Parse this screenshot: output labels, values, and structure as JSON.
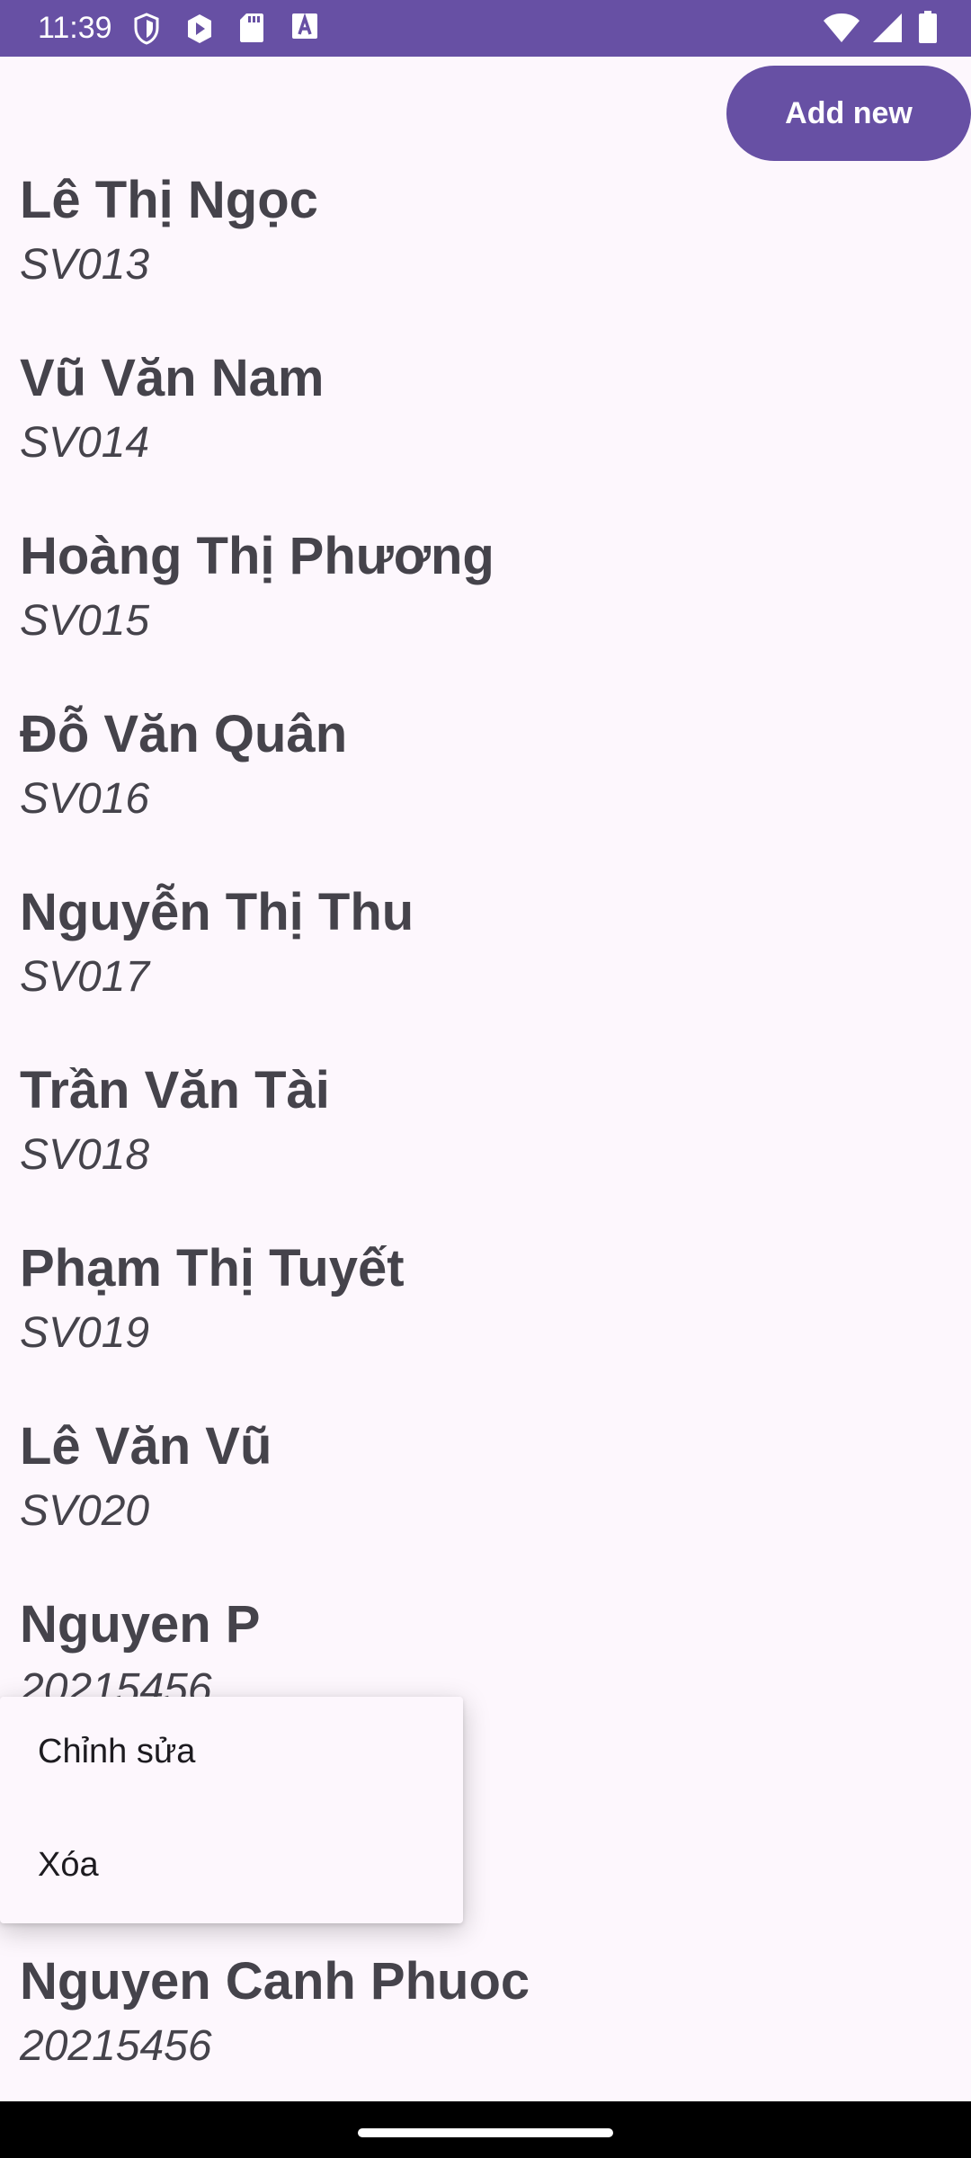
{
  "status_bar": {
    "time": "11:39",
    "icons_left": [
      "shield-icon",
      "play-store-icon",
      "sd-card-icon",
      "font-a-icon"
    ],
    "icons_right": [
      "wifi-icon",
      "cell-signal-icon",
      "battery-icon"
    ],
    "color": "#6750a4"
  },
  "header": {
    "add_button_label": "Add new"
  },
  "students": [
    {
      "name": "Lê Thị Ngọc",
      "id": "SV013"
    },
    {
      "name": "Vũ Văn Nam",
      "id": "SV014"
    },
    {
      "name": "Hoàng Thị Phương",
      "id": "SV015"
    },
    {
      "name": "Đỗ Văn Quân",
      "id": "SV016"
    },
    {
      "name": "Nguyễn Thị Thu",
      "id": "SV017"
    },
    {
      "name": "Trần Văn Tài",
      "id": "SV018"
    },
    {
      "name": "Phạm Thị Tuyết",
      "id": "SV019"
    },
    {
      "name": "Lê Văn Vũ",
      "id": "SV020"
    },
    {
      "name": "Nguyen P",
      "id": "20215456"
    },
    {
      "name": "Nguyen Canh Phuoc",
      "id": "20215456"
    }
  ],
  "context_menu": {
    "items": [
      {
        "label": "Chỉnh sửa"
      },
      {
        "label": "Xóa"
      }
    ]
  },
  "colors": {
    "accent": "#6750a4",
    "background": "#fdf7fd",
    "text": "#45434b"
  }
}
